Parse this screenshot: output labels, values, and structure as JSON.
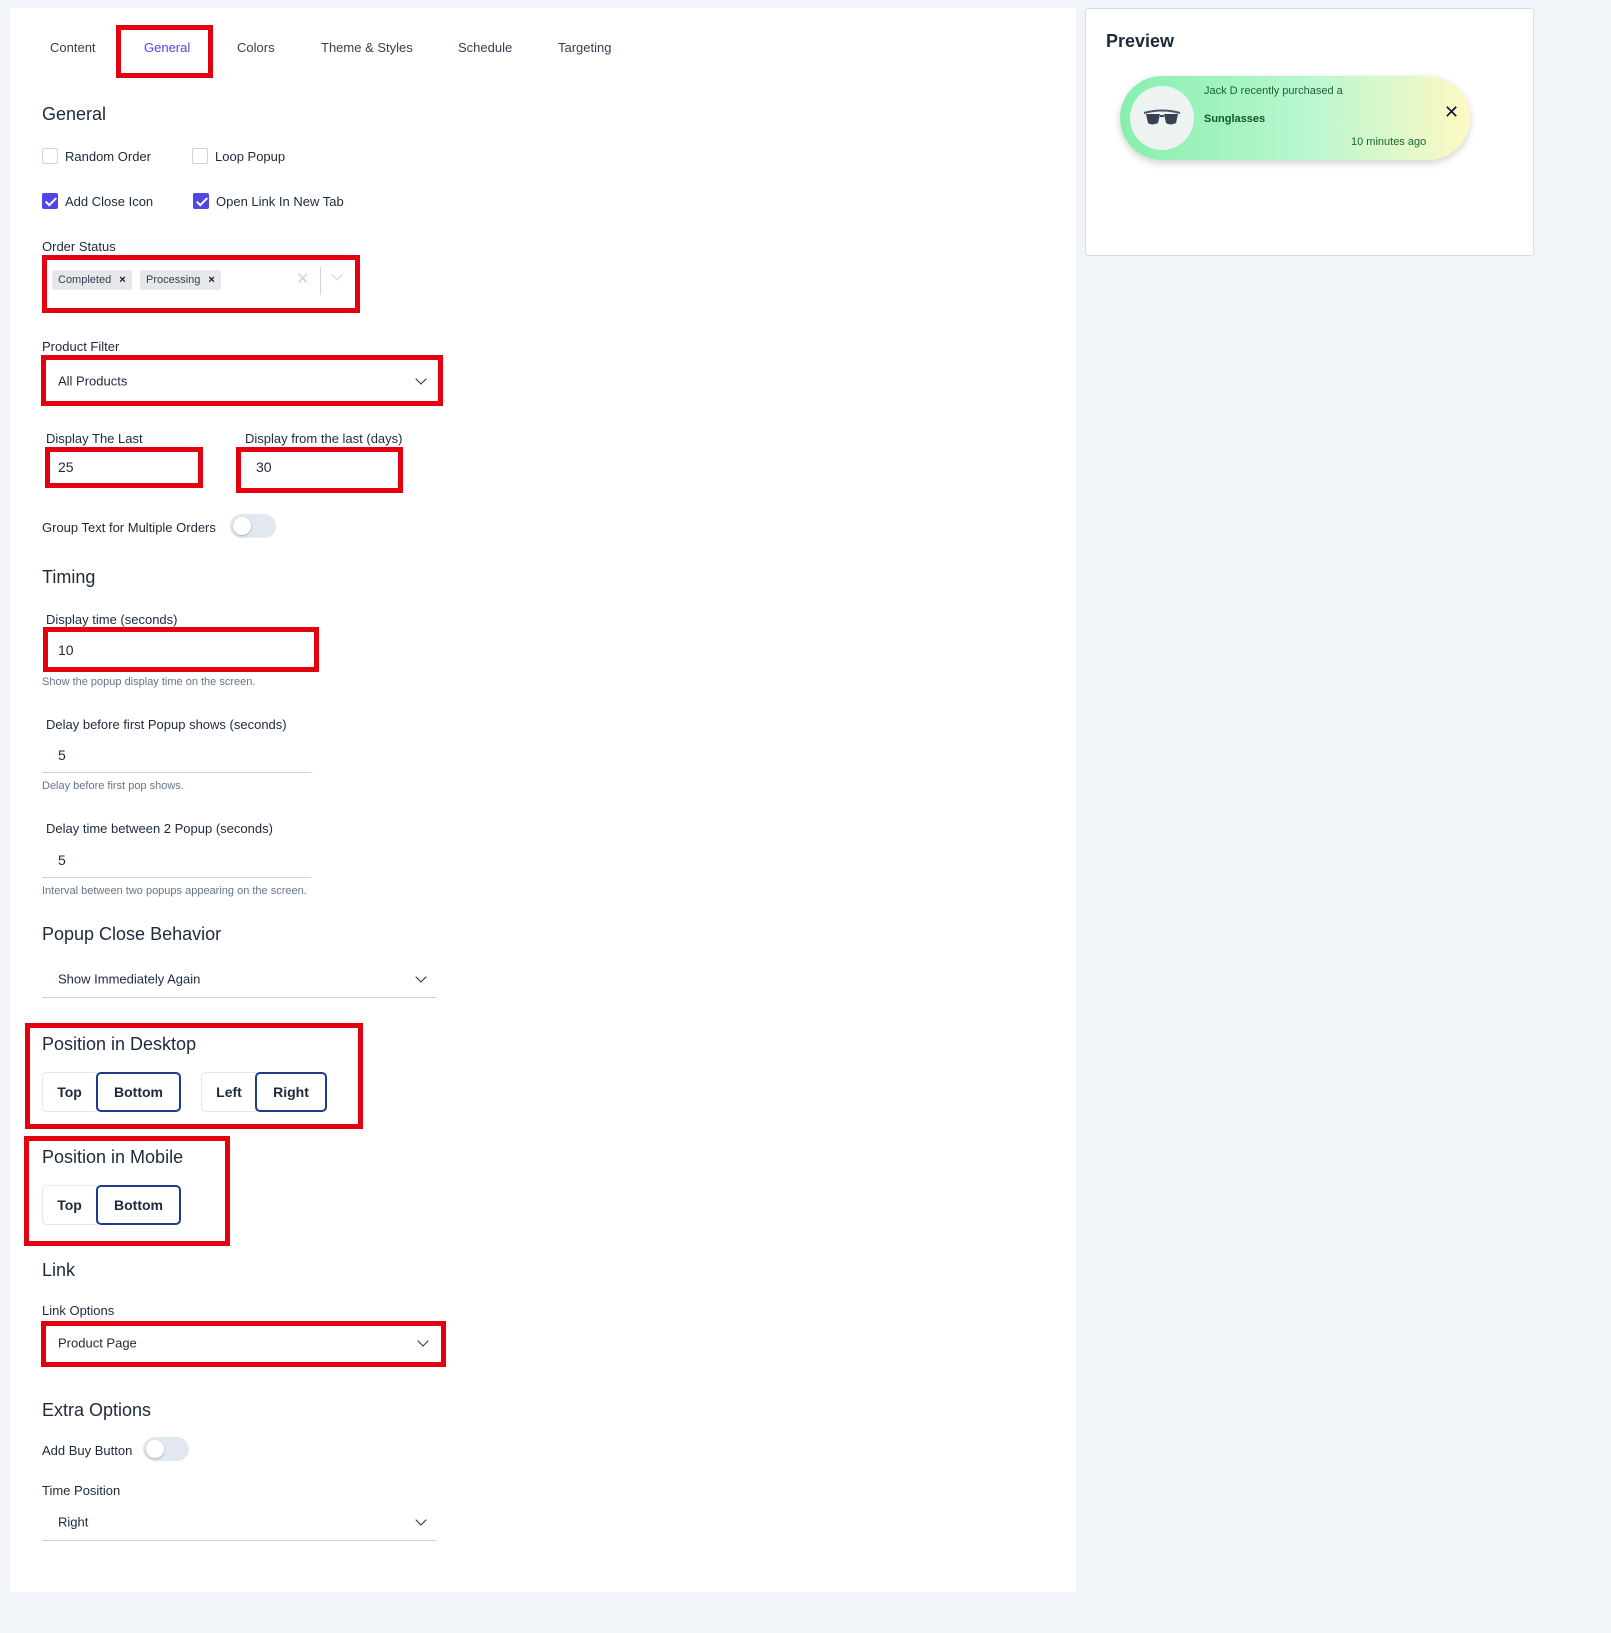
{
  "tabs": [
    "Content",
    "General",
    "Colors",
    "Theme & Styles",
    "Schedule",
    "Targeting"
  ],
  "general": {
    "title": "General",
    "checkboxes": {
      "random_order": "Random Order",
      "loop_popup": "Loop Popup",
      "add_close_icon": "Add Close Icon",
      "open_link_new_tab": "Open Link In New Tab"
    },
    "order_status": {
      "label": "Order Status",
      "chips": [
        "Completed",
        "Processing"
      ]
    },
    "product_filter": {
      "label": "Product Filter",
      "value": "All Products"
    },
    "display_last": {
      "label": "Display The Last",
      "value": "25"
    },
    "display_days": {
      "label": "Display from the last (days)",
      "value": "30"
    },
    "group_text": "Group Text for Multiple Orders"
  },
  "timing": {
    "title": "Timing",
    "display_time": {
      "label": "Display time (seconds)",
      "value": "10",
      "help": "Show the popup display time on the screen."
    },
    "delay_first": {
      "label": "Delay before first Popup shows (seconds)",
      "value": "5",
      "help": "Delay before first pop shows."
    },
    "delay_between": {
      "label": "Delay time between 2 Popup (seconds)",
      "value": "5",
      "help": "Interval between two popups appearing on the screen."
    }
  },
  "close_behavior": {
    "title": "Popup Close Behavior",
    "value": "Show Immediately Again"
  },
  "position_desktop": {
    "title": "Position in Desktop",
    "vertical": [
      "Top",
      "Bottom"
    ],
    "horizontal": [
      "Left",
      "Right"
    ]
  },
  "position_mobile": {
    "title": "Position in Mobile",
    "vertical": [
      "Top",
      "Bottom"
    ]
  },
  "link": {
    "title": "Link",
    "label": "Link Options",
    "value": "Product Page"
  },
  "extra": {
    "title": "Extra Options",
    "buy_button": "Add Buy Button",
    "time_position_label": "Time Position",
    "time_position_value": "Right"
  },
  "preview": {
    "title": "Preview",
    "message": "Jack D recently purchased a",
    "product": "Sunglasses",
    "time": "10 minutes ago",
    "close_glyph": "✕"
  },
  "colors": {
    "accent": "#4f46e5",
    "highlight": "#e3000f",
    "selected_border": "#1e3a8a"
  }
}
